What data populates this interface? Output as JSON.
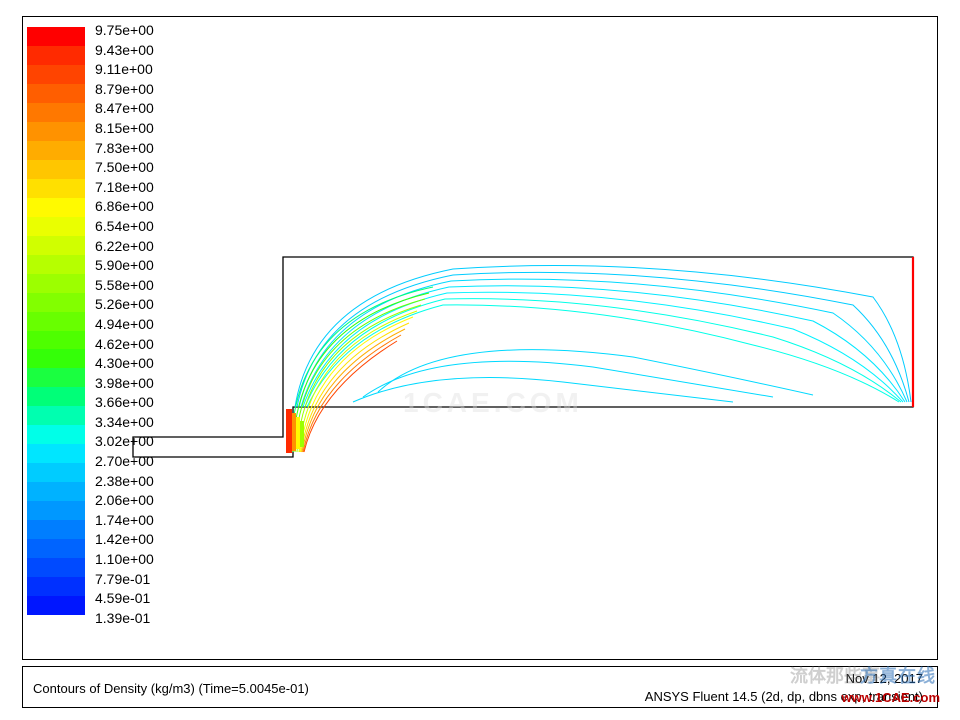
{
  "caption": {
    "title": "Contours of Density (kg/m3)  (Time=5.0045e-01)",
    "date": "Nov 12, 2017",
    "footer": "ANSYS Fluent 14.5 (2d, dp, dbns exp, transient)"
  },
  "watermarks": {
    "site": "www.1CAE.com",
    "cn1": "方真在线",
    "cn2": "流体那些事",
    "center": "1CAE.COM"
  },
  "legend": {
    "labels": [
      "9.75e+00",
      "9.43e+00",
      "9.11e+00",
      "8.79e+00",
      "8.47e+00",
      "8.15e+00",
      "7.83e+00",
      "7.50e+00",
      "7.18e+00",
      "6.86e+00",
      "6.54e+00",
      "6.22e+00",
      "5.90e+00",
      "5.58e+00",
      "5.26e+00",
      "4.94e+00",
      "4.62e+00",
      "4.30e+00",
      "3.98e+00",
      "3.66e+00",
      "3.34e+00",
      "3.02e+00",
      "2.70e+00",
      "2.38e+00",
      "2.06e+00",
      "1.74e+00",
      "1.42e+00",
      "1.10e+00",
      "7.79e-01",
      "4.59e-01",
      "1.39e-01"
    ],
    "colors": [
      "#ff0000",
      "#ff2a00",
      "#ff4400",
      "#ff5e00",
      "#ff7800",
      "#ff9200",
      "#ffac00",
      "#ffc600",
      "#ffe000",
      "#fffa00",
      "#eaff00",
      "#d0ff00",
      "#b6ff00",
      "#9cff00",
      "#82ff00",
      "#68ff00",
      "#4eff00",
      "#34ff08",
      "#1aff40",
      "#00ff78",
      "#00ffb0",
      "#00ffe8",
      "#00e6ff",
      "#00ccff",
      "#00b2ff",
      "#0098ff",
      "#007eff",
      "#0064ff",
      "#004aff",
      "#0030ff",
      "#0016ff"
    ]
  },
  "chart_data": {
    "type": "contour",
    "variable": "Density",
    "units": "kg/m3",
    "time": 0.50045,
    "software": "ANSYS Fluent 14.5",
    "solver": "2d, dp, dbns exp, transient",
    "levels": [
      0.139,
      0.459,
      0.779,
      1.1,
      1.42,
      1.74,
      2.06,
      2.38,
      2.7,
      3.02,
      3.34,
      3.66,
      3.98,
      4.3,
      4.62,
      4.94,
      5.26,
      5.58,
      5.9,
      6.22,
      6.54,
      6.86,
      7.18,
      7.5,
      7.83,
      8.15,
      8.47,
      8.79,
      9.11,
      9.43,
      9.75
    ],
    "range": [
      0.139,
      9.75
    ],
    "geometry": "forward-facing step in channel (bow shock over step)"
  }
}
